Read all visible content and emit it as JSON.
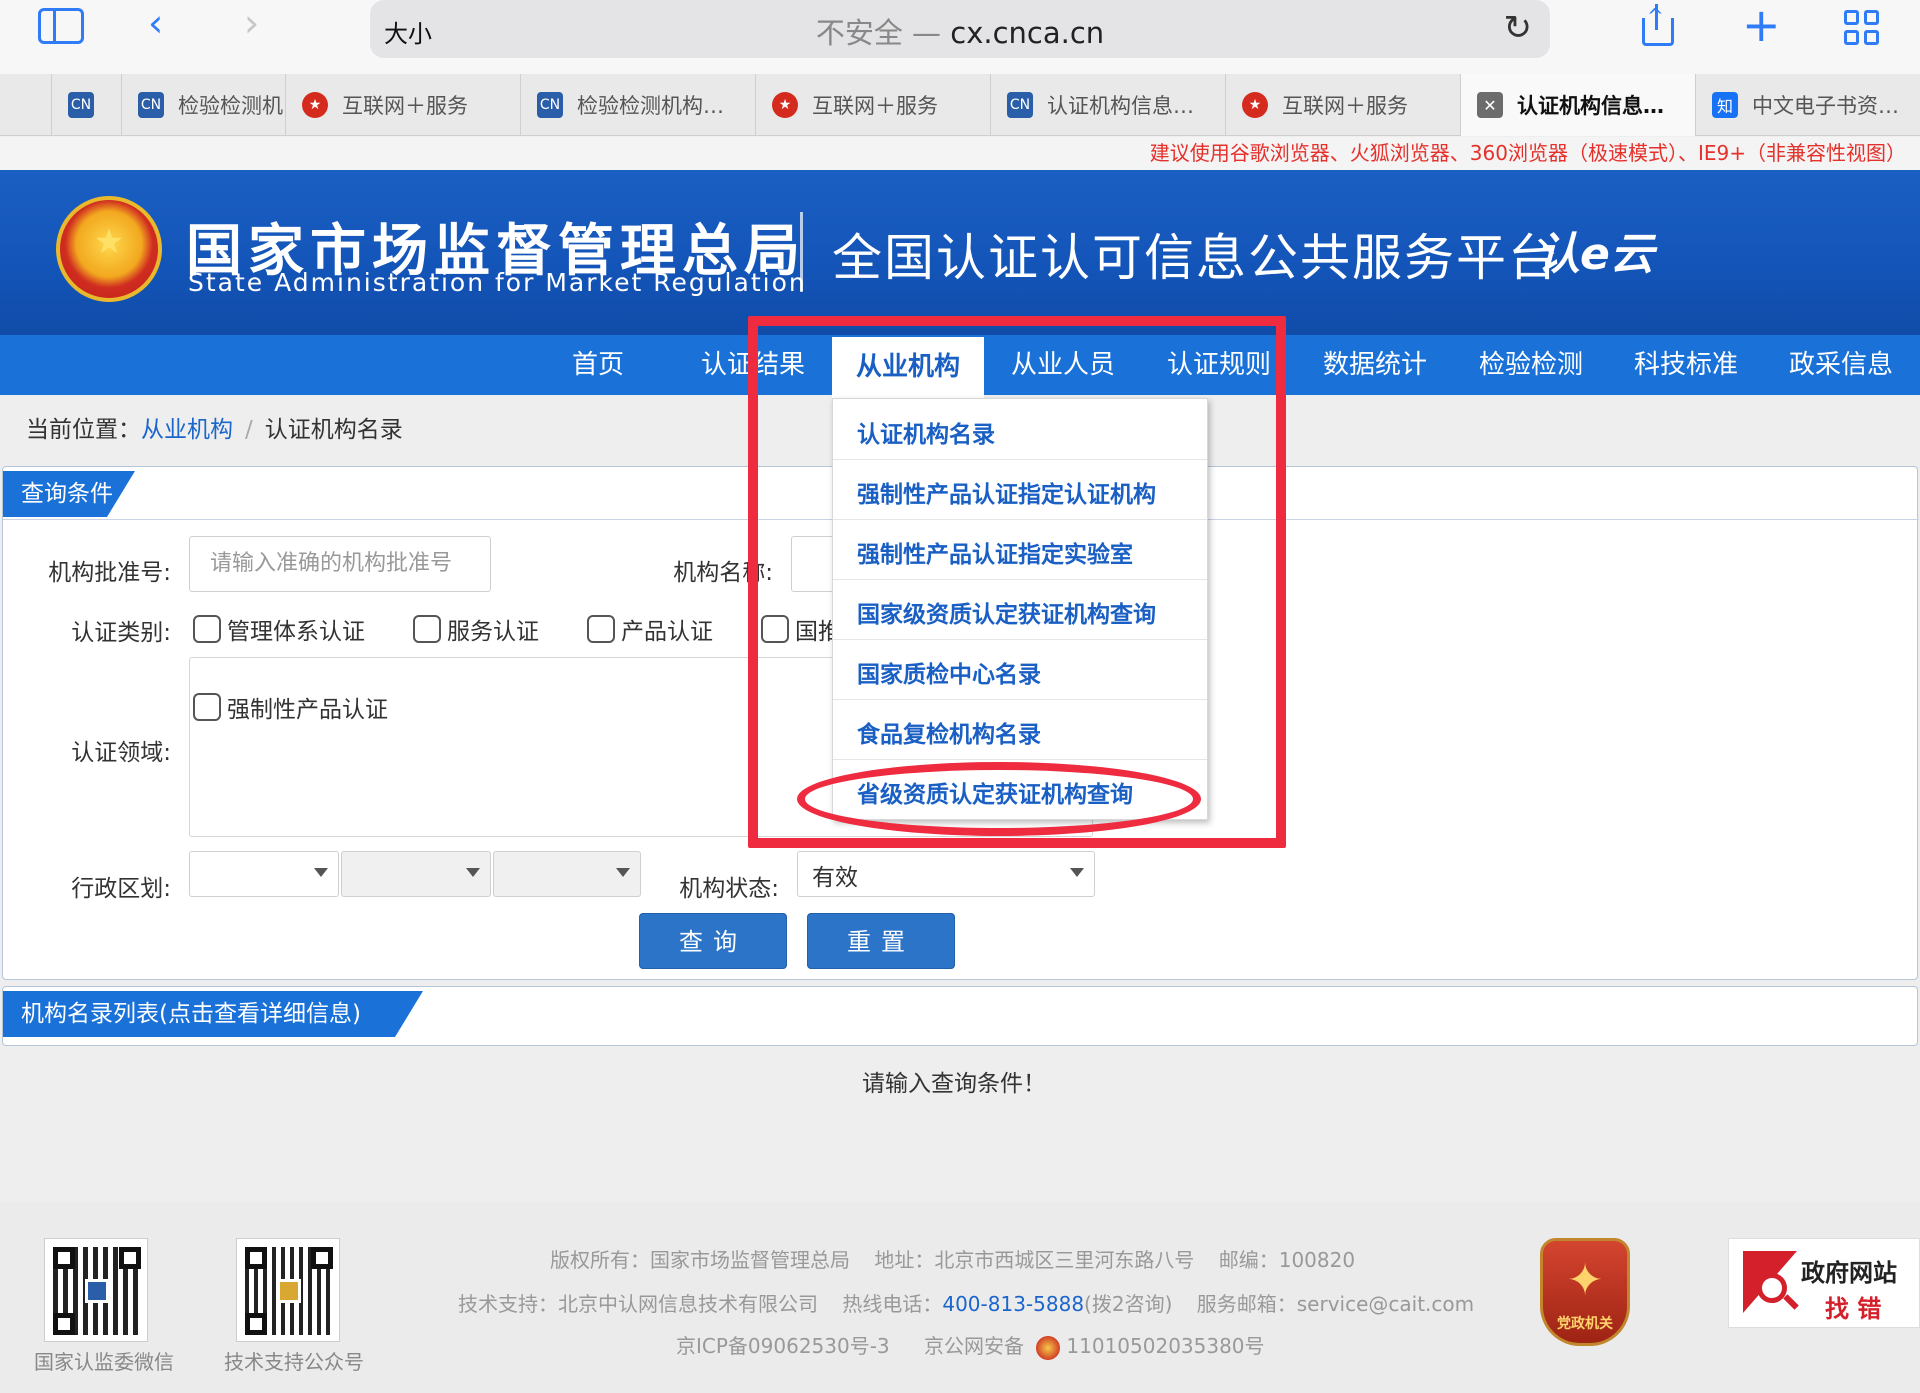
{
  "browser": {
    "address_size_label": "大小",
    "security_label": "不安全 —",
    "url": "cx.cnca.cn",
    "tabs": [
      {
        "label": "",
        "icon": "blank"
      },
      {
        "label": "",
        "icon": "cnca-icon"
      },
      {
        "label": "检验检测机",
        "icon": "cnca-icon"
      },
      {
        "label": "互联网＋服务",
        "icon": "emblem-icon"
      },
      {
        "label": "检验检测机构…",
        "icon": "cnca-icon"
      },
      {
        "label": "互联网＋服务",
        "icon": "emblem-icon"
      },
      {
        "label": "认证机构信息…",
        "icon": "cnca-icon"
      },
      {
        "label": "互联网＋服务",
        "icon": "emblem-icon"
      },
      {
        "label": "认证机构信息…",
        "icon": "close-icon"
      },
      {
        "label": "中文电子书资…",
        "icon": "zhihu-icon"
      }
    ],
    "favicon_text": {
      "cnca": "CN",
      "zhihu": "知",
      "close": "✕"
    }
  },
  "notice": "建议使用谷歌浏览器、火狐浏览器、360浏览器（极速模式）、IE9+（非兼容性视图）",
  "header": {
    "org_cn": "国家市场监督管理总局",
    "org_en": "State Administration  for  Market Regulation",
    "platform": "全国认证认可信息公共服务平台",
    "cloud_logo": "认e云"
  },
  "nav": {
    "items": [
      "首页",
      "认证结果",
      "从业机构",
      "从业人员",
      "认证规则",
      "数据统计",
      "检验检测",
      "科技标准",
      "政采信息"
    ],
    "active_index": 2
  },
  "breadcrumb": {
    "prefix": "当前位置：",
    "link": "从业机构",
    "separator": "/",
    "current": "认证机构名录"
  },
  "query_panel": {
    "title": "查询条件",
    "approval_label": "机构批准号:",
    "approval_placeholder": "请输入准确的机构批准号",
    "name_label": "机构名称:",
    "category_label": "认证类别:",
    "categories": [
      "管理体系认证",
      "服务认证",
      "产品认证",
      "国推"
    ],
    "domain_label": "认证领域:",
    "domain_options": [
      "强制性产品认证"
    ],
    "region_label": "行政区划:",
    "status_label": "机构状态:",
    "status_value": "有效",
    "query_button": "查询",
    "reset_button": "重置"
  },
  "list_panel": {
    "title": "机构名录列表(点击查看详细信息)",
    "empty_message": "请输入查询条件！"
  },
  "dropdown": {
    "items": [
      "认证机构名录",
      "强制性产品认证指定认证机构",
      "强制性产品认证指定实验室",
      "国家级资质认定获证机构查询",
      "国家质检中心名录",
      "食品复检机构名录",
      "省级资质认定获证机构查询"
    ]
  },
  "footer": {
    "qr_captions": [
      "国家认监委微信",
      "技术支持公众号"
    ],
    "copyright_label": "版权所有：",
    "copyright": "国家市场监督管理总局",
    "address_label": "地址：",
    "address": "北京市西城区三里河东路八号",
    "postcode_label": "邮编：",
    "postcode": "100820",
    "support_label": "技术支持：",
    "support": "北京中认网信息技术有限公司",
    "hotline_label": "热线电话：",
    "hotline": "400-813-5888",
    "hotline_note": "(拨2咨询)",
    "email_label": "服务邮箱：",
    "email": "service@cait.com",
    "icp": "京ICP备09062530号-3",
    "police_label": "京公网安备",
    "police": "11010502035380号",
    "party_badge": "党政机关",
    "gov_badge_title": "政府网站",
    "gov_badge_sub": "找 错"
  },
  "colors": {
    "brand_blue": "#1a72d9",
    "header_blue": "#1354b8",
    "annotation_red": "#ee2b3f",
    "notice_red": "#e5312b",
    "link_blue": "#1a5fc4"
  }
}
